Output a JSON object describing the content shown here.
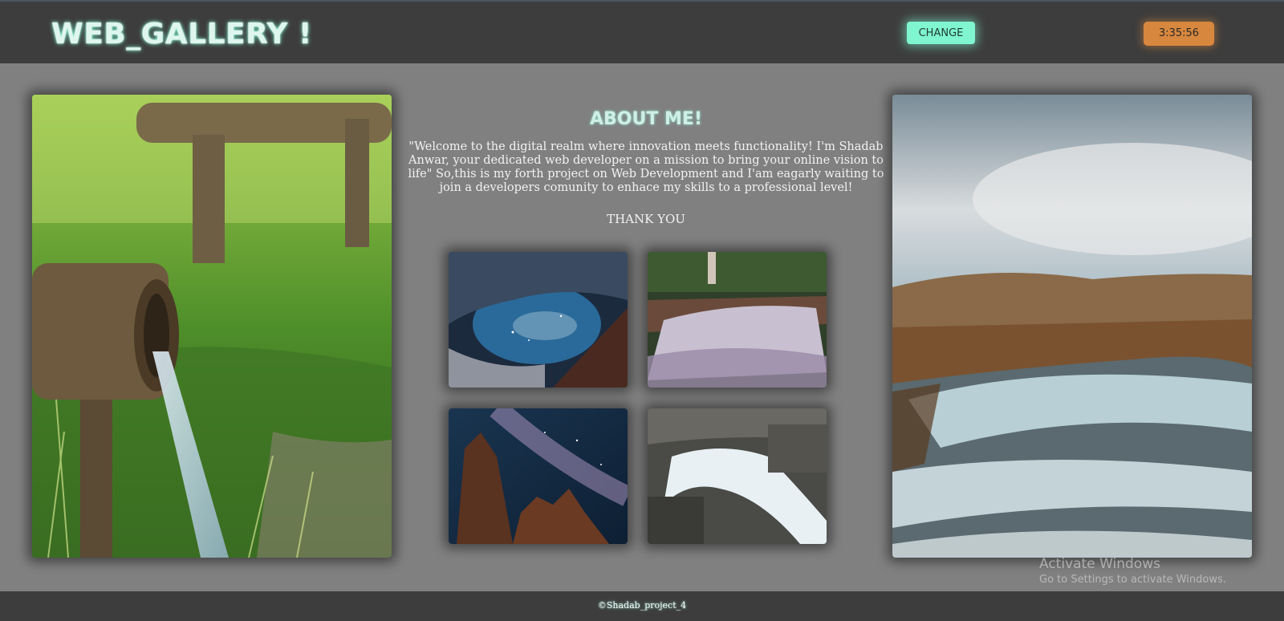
{
  "header": {
    "logo": "WEB_GALLERY !",
    "change_button": "CHANGE",
    "clock": "3:35:56"
  },
  "about": {
    "title": "ABOUT ME!",
    "paragraph": "\"Welcome to the digital realm where innovation meets functionality! I'm Shadab Anwar, your dedicated web developer on a mission to bring your online vision to life\" So,this is my forth project on Web Development and I'am eagarly waiting to join a developers comunity to enhace my skills to a professional level!",
    "thanks": "THANK YOU"
  },
  "gallery": {
    "left_image": "water-pipe-photo",
    "right_image": "mountain-river-photo",
    "thumbnails": [
      "starry-cave-photo",
      "waterfall-photo",
      "milky-way-rocks-photo",
      "rocky-stream-photo"
    ]
  },
  "watermark": {
    "title": "Activate Windows",
    "subtitle": "Go to Settings to activate Windows."
  },
  "footer": {
    "text": "©Shadab_project_4"
  }
}
